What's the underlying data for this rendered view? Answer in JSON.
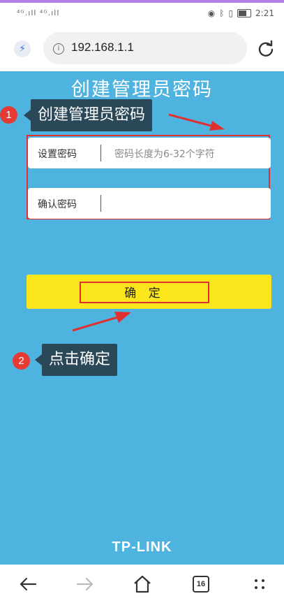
{
  "status_bar": {
    "signal_left": "⁴ᴳ.ıll ⁴ᴳ.ıll",
    "time": "2:21"
  },
  "browser": {
    "url": "192.168.1.1"
  },
  "page": {
    "title": "创建管理员密码",
    "callout_1": {
      "badge": "1",
      "text": "创建管理员密码"
    },
    "callout_2": {
      "badge": "2",
      "text": "点击确定"
    },
    "fields": {
      "set_password_label": "设置密码",
      "set_password_placeholder": "密码长度为6-32个字符",
      "confirm_password_label": "确认密码",
      "confirm_password_value": ""
    },
    "confirm_button": "确 定",
    "logo": "TP-LINK"
  },
  "bottom_nav": {
    "tab_count": "16"
  },
  "colors": {
    "page_bg": "#4fb3df",
    "button": "#fbe61b",
    "callout": "#2b4858",
    "highlight": "#e03030"
  }
}
